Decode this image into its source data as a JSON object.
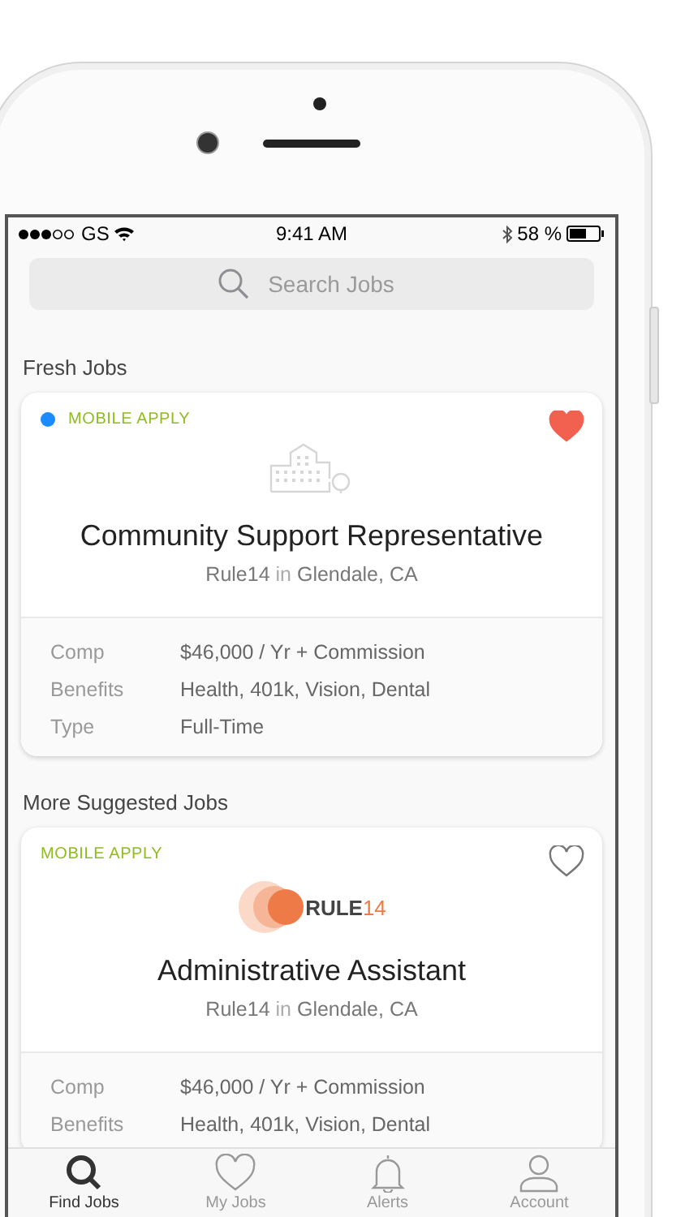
{
  "status_bar": {
    "carrier": "GS",
    "time": "9:41 AM",
    "battery": "58 %"
  },
  "search": {
    "placeholder": "Search Jobs"
  },
  "sections": [
    {
      "title": "Fresh Jobs",
      "jobs": [
        {
          "badge": "MOBILE APPLY",
          "unread": true,
          "saved": true,
          "logo": {
            "kind": "building"
          },
          "title": "Community Support Representative",
          "company": "Rule14",
          "connector": "in",
          "location": "Glendale, CA",
          "details": [
            {
              "label": "Comp",
              "value": "$46,000 / Yr + Commission"
            },
            {
              "label": "Benefits",
              "value": "Health, 401k, Vision, Dental"
            },
            {
              "label": "Type",
              "value": "Full-Time"
            }
          ]
        }
      ]
    },
    {
      "title": "More Suggested Jobs",
      "jobs": [
        {
          "badge": "MOBILE APPLY",
          "unread": false,
          "saved": false,
          "logo": {
            "kind": "brand",
            "name": "RULE",
            "number": "14"
          },
          "title": "Administrative Assistant",
          "company": "Rule14",
          "connector": "in",
          "location": "Glendale, CA",
          "details": [
            {
              "label": "Comp",
              "value": "$46,000 / Yr + Commission"
            },
            {
              "label": "Benefits",
              "value": "Health, 401k, Vision, Dental"
            }
          ]
        }
      ]
    }
  ],
  "tabs": [
    {
      "kind": "search",
      "label": "Find Jobs",
      "selected": true
    },
    {
      "kind": "heart",
      "label": "My Jobs",
      "selected": false
    },
    {
      "kind": "bell",
      "label": "Alerts",
      "selected": false
    },
    {
      "kind": "person",
      "label": "Account",
      "selected": false
    }
  ]
}
